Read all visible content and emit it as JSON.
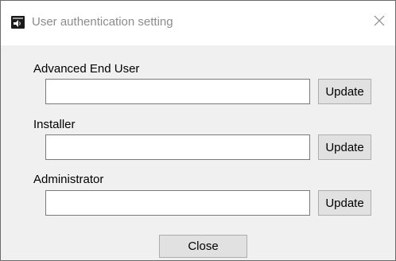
{
  "window": {
    "title": "User authentication setting",
    "icon": "speaker-app-icon",
    "close_icon": "close-icon"
  },
  "fields": [
    {
      "label": "Advanced End User",
      "value": "",
      "button": "Update"
    },
    {
      "label": "Installer",
      "value": "",
      "button": "Update"
    },
    {
      "label": "Administrator",
      "value": "",
      "button": "Update"
    }
  ],
  "footer": {
    "close_label": "Close"
  }
}
